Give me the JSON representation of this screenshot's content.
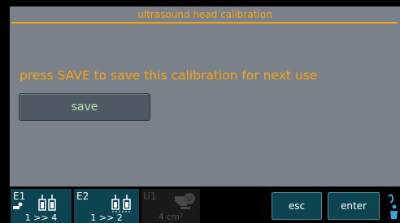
{
  "header": {
    "title": "ultrasound head calibration"
  },
  "main": {
    "message": "press SAVE to save this calibration for next use",
    "save_label": "save"
  },
  "footer": {
    "e1": {
      "label": "E1",
      "ratio": "1 >> 4",
      "icon": "electrode-pair-icon"
    },
    "e2": {
      "label": "E2",
      "ratio": "1 >> 2",
      "icon": "electrode-pair-icon"
    },
    "u1": {
      "label": "U1",
      "area": "4 cm²",
      "icon": "ultrasound-head-icon"
    },
    "esc_label": "esc",
    "enter_label": "enter"
  },
  "colors": {
    "accent": "#f5a60e",
    "panel": "#7b818b",
    "button": "#4f5966",
    "footer_tile": "#0d4452"
  }
}
